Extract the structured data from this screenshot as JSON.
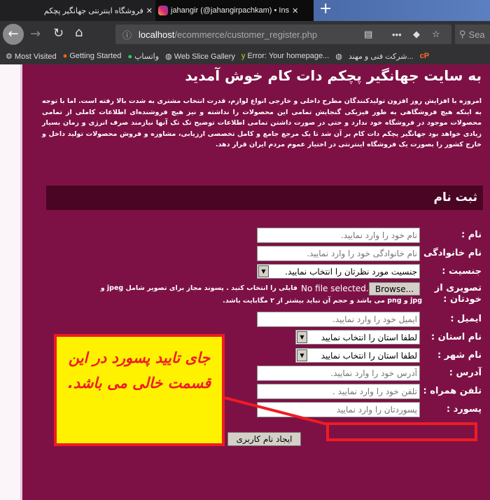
{
  "browser": {
    "tabs": [
      {
        "title": "فروشگاه اینترنتی جهانگیر پچکم",
        "active": false
      },
      {
        "title": "jahangir (@jahangirpachkam) • Ins",
        "active": true
      }
    ],
    "url_host": "localhost",
    "url_path": "/ecommerce/customer_register.php",
    "search_placeholder": "Sea",
    "bookmarks": [
      "Most Visited",
      "Getting Started",
      "واتساپ",
      "Web Slice Gallery",
      "Error: Your homepage...",
      "شرکت فنی و مهند..."
    ]
  },
  "page": {
    "title": "به سایت جهانگیر پچکم دات کام خوش آمدید",
    "intro": "امروزه با افزایش روز افزون تولیدکنندگان مطرح داخلی و خارجی انواع لوازم، قدرت انتخاب مشتری به شدت بالا رفته است. اما با توجه به اینکه هیچ فروشگاهی به طور فیزیکی گنجایش تمامی این محصولات را نداشته و نیز هیچ فروشنده‌ای اطلاعات کاملی از تمامی محصولات موجود در فروشگاه خود ندارد و حتی در صورت داشتن تمامی اطلاعات توضیح تک تک آنها نیازمند صرف انرژی و زمان بسیار زیادی خواهد بود جهانگیر پچکم دات کام بر آن شد تا یک مرجع جامع و کامل تخصصی ارزیابی، مشاوره و فروش محصولات تولید داخل و خارج کشور را بصورت یک فروشگاه اینترنتی در اختیار عموم مردم ایران قرار دهد.",
    "register_heading": "ثبت نام",
    "form": {
      "name": {
        "label": "نام :",
        "placeholder": "نام خود را وارد نمایید."
      },
      "family": {
        "label": "نام خانوادگی :",
        "placeholder": "نام خانوادگی خود را وارد نمایید."
      },
      "gender": {
        "label": "جنسیت :",
        "value": "جنسیت مورد نظرتان را انتخاب نمایید."
      },
      "photo": {
        "label1": "تصویری از",
        "label2": "خودتان :",
        "browse": "Browse...",
        "status": "No file selected.",
        "hint1": "فایلی را انتخاب کنید . پسوند مجاز برای تصویر شامل jpeg و",
        "hint2": "jpg و png می باشد و حجم آن نباید بیشتر از ۲ مگابایت باشد."
      },
      "email": {
        "label": "ایمیل :",
        "placeholder": "ایمیل خود را وارد نمایید."
      },
      "province": {
        "label": "نام استان :",
        "value": "لطفا استان را انتخاب نمایید"
      },
      "city": {
        "label": "نام شهر :",
        "value": "لطفا استان را انتخاب نمایید"
      },
      "address": {
        "label": "آدرس :",
        "placeholder": "آدرس خود را وارد نمایید."
      },
      "phone": {
        "label": "تلفن همراه :",
        "placeholder": "تلفن خود را وارد نمایید ."
      },
      "password": {
        "label": "پسورد :",
        "placeholder": "پسوردتان را وارد نمایید"
      },
      "submit": "ایجاد نام کاربری"
    }
  },
  "annotation": {
    "text": "جای تایید پسورد در این قسمت خالی می باشد.",
    "color": "#ee1c24",
    "background": "#fff200"
  }
}
